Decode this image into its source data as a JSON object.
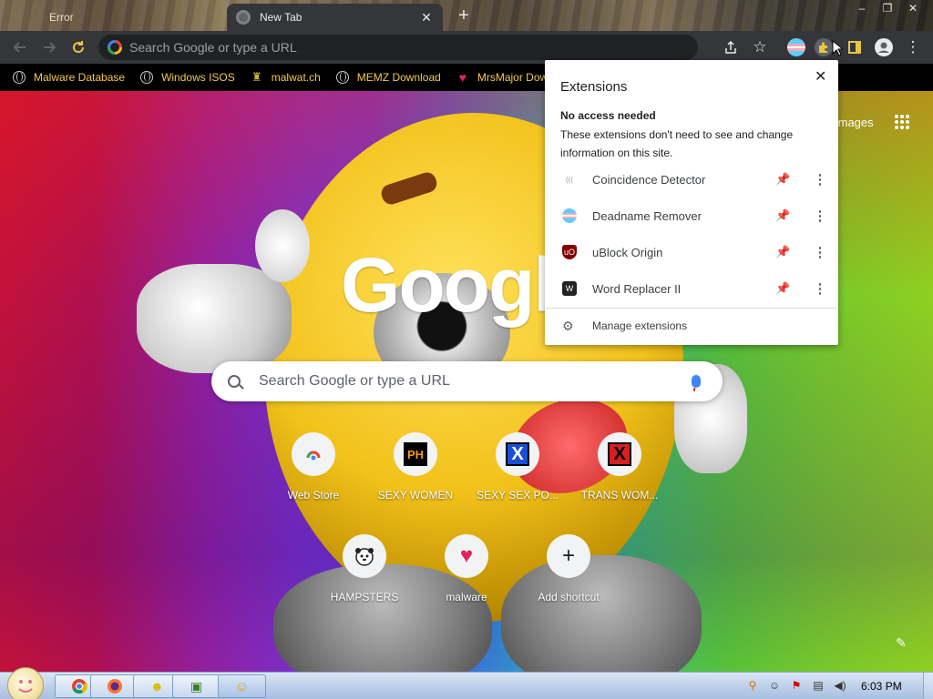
{
  "tabs": [
    {
      "title": "Error",
      "active": false
    },
    {
      "title": "New Tab",
      "active": true
    }
  ],
  "window_controls": {
    "min": "–",
    "restore": "❐",
    "close": "✕"
  },
  "toolbar": {
    "omnibox_placeholder": "Search Google or type a URL"
  },
  "bookmarks": [
    {
      "label": "Malware Database",
      "icon": "globe-icon"
    },
    {
      "label": "Windows ISOS",
      "icon": "globe-icon"
    },
    {
      "label": "malwat.ch",
      "icon": "trophy-icon"
    },
    {
      "label": "MEMZ Download",
      "icon": "globe-icon"
    },
    {
      "label": "MrsMajor Dow",
      "icon": "heart-icon"
    }
  ],
  "ntp": {
    "logo": "Google",
    "images_link": "Images",
    "search_placeholder": "Search Google or type a URL",
    "shortcuts": [
      {
        "label": "Web Store"
      },
      {
        "label": "SEXY WOMEN"
      },
      {
        "label": "SEXY SEX PO..."
      },
      {
        "label": "TRANS WOM..."
      },
      {
        "label": "HAMPSTERS"
      },
      {
        "label": "malware"
      },
      {
        "label": "Add shortcut"
      }
    ]
  },
  "extensions_popup": {
    "title": "Extensions",
    "section_title": "No access needed",
    "section_desc": "These extensions don't need to see and change information on this site.",
    "items": [
      {
        "name": "Coincidence Detector",
        "pinned": false
      },
      {
        "name": "Deadname Remover",
        "pinned": true
      },
      {
        "name": "uBlock Origin",
        "pinned": false
      },
      {
        "name": "Word Replacer II",
        "pinned": false
      }
    ],
    "manage_label": "Manage extensions"
  },
  "taskbar": {
    "clock": "6:03 PM"
  },
  "colors": {
    "toolbar_bg": "#35363a",
    "bookmark_text": "#f2c94c",
    "pin_active": "#1a73e8"
  }
}
